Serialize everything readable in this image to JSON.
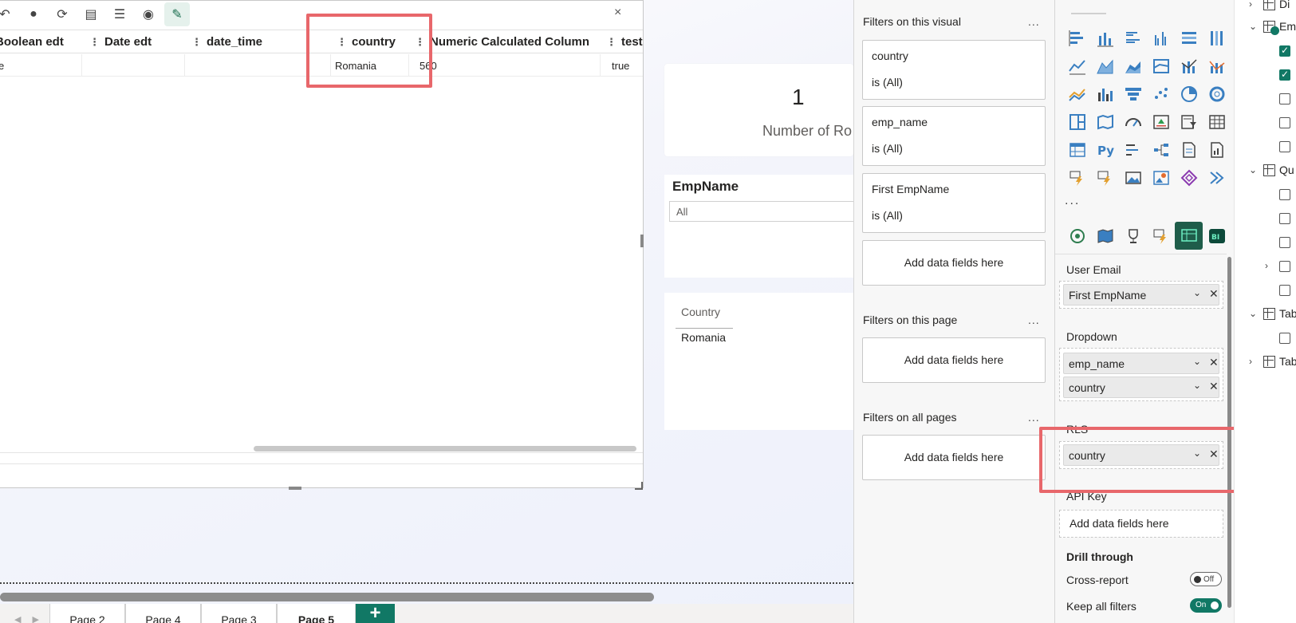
{
  "grid": {
    "columns": [
      "Boolean edt",
      "Date edt",
      "date_time",
      "country",
      "Numeric Calculated Column",
      "test"
    ],
    "row": {
      "boolean": "e",
      "date": "",
      "datetime": "",
      "country": "Romania",
      "numeric": "560",
      "test": "true"
    },
    "close_glyph": "×"
  },
  "card": {
    "value": "1",
    "label": "Number of Ro"
  },
  "slicer": {
    "title": "EmpName",
    "selected": "All"
  },
  "table_visual": {
    "header": "Country",
    "value": "Romania"
  },
  "page_tabs": [
    "Page 2",
    "Page 4",
    "Page 3",
    "Page 5"
  ],
  "active_tab": "Page 5",
  "add_tab": "+",
  "filters": {
    "visual_title": "Filters on this visual",
    "visual_filters": [
      {
        "name": "country",
        "value": "is (All)"
      },
      {
        "name": "emp_name",
        "value": "is (All)"
      },
      {
        "name": "First EmpName",
        "value": "is (All)"
      }
    ],
    "add_fields": "Add data fields here",
    "page_title": "Filters on this page",
    "all_title": "Filters on all pages",
    "more": "..."
  },
  "viz": {
    "more": "...",
    "wells": {
      "user_email": {
        "label": "User Email",
        "fields": [
          "First EmpName"
        ]
      },
      "dropdown": {
        "label": "Dropdown",
        "fields": [
          "emp_name",
          "country"
        ]
      },
      "rls": {
        "label": "RLS",
        "fields": [
          "country"
        ]
      },
      "api_key": {
        "label": "API Key",
        "placeholder": "Add data fields here"
      }
    },
    "drill_through": "Drill through",
    "cross_report": {
      "label": "Cross-report",
      "state": "Off"
    },
    "keep_filters": {
      "label": "Keep all filters",
      "state": "On"
    }
  },
  "data_pane": {
    "items": [
      "Di",
      "Em",
      "Qu",
      "Tab",
      "Tab"
    ]
  },
  "colors": {
    "accent": "#117865",
    "highlight": "#e8676b"
  }
}
